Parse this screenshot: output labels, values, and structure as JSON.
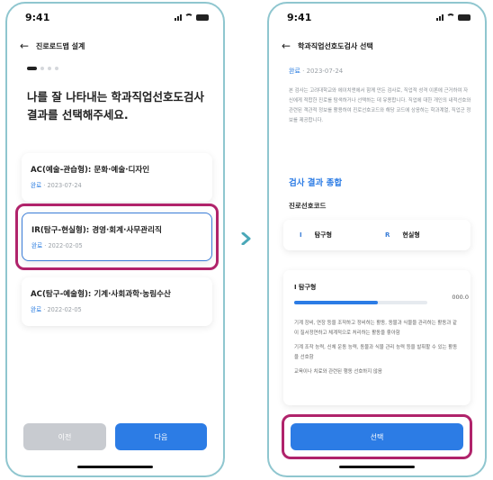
{
  "accent": "#2c7ce5",
  "highlight_color": "#b0236b",
  "left": {
    "status_time": "9:41",
    "nav_title": "진로로드맵 설계",
    "heading_line1": "나를 잘 나타내는 학과직업선호도검사",
    "heading_line2": "결과를 선택해주세요.",
    "cards": [
      {
        "title": "AC(예술-관습형): 문화·예술·디자인",
        "status": "완료",
        "date": "2023-07-24"
      },
      {
        "title": "IR(탐구-현실형): 경영·회계·사무관리직",
        "status": "완료",
        "date": "2022-02-05"
      },
      {
        "title": "AC(탐구-예술형): 기계·사회과학·농림수산",
        "status": "완료",
        "date": "2022-02-05"
      }
    ],
    "prev_label": "이전",
    "next_label": "다음"
  },
  "right": {
    "status_time": "9:41",
    "nav_title": "학과직업선호도검사 선택",
    "status": "완료",
    "date": "2023-07-24",
    "description": "본 검사는 고려대학교와 에이치앤에서 함께 만든 검사로, 직업적 성격 이론에 근거하여 자신에게 적합한 진로를 탐색하거나 선택하는 데 유용합니다. 직업에 대한 개인의 내적선호와 관련된 객관적 정보를 활용하여 진로선호코드와 해당 코드에 상응하는 학과계열, 직업군 정보를 제공합니다.",
    "section_title": "검사 결과 종합",
    "code_label": "진로선호코드",
    "codes": [
      {
        "letter": "I",
        "name": "탐구형"
      },
      {
        "letter": "R",
        "name": "현실형"
      }
    ],
    "result_title": "I 탐구형",
    "score": "000.0",
    "progress": 0.63,
    "paragraphs": [
      "기계 장비, 연장 등을 조작하고 정비하는 활동, 동물과 식물을 관리하는 활동과 같이 질서정연하고 체계적으로 처리하는 활동을 좋아함",
      "기계 조작 능력, 신체 운동 능력, 동물과 식물 관리 능력 등을 발휘할 수 있는 활동을 선호함",
      "교육이나 치료와 관련된 행동 선호하지 않음"
    ],
    "select_label": "선택"
  }
}
